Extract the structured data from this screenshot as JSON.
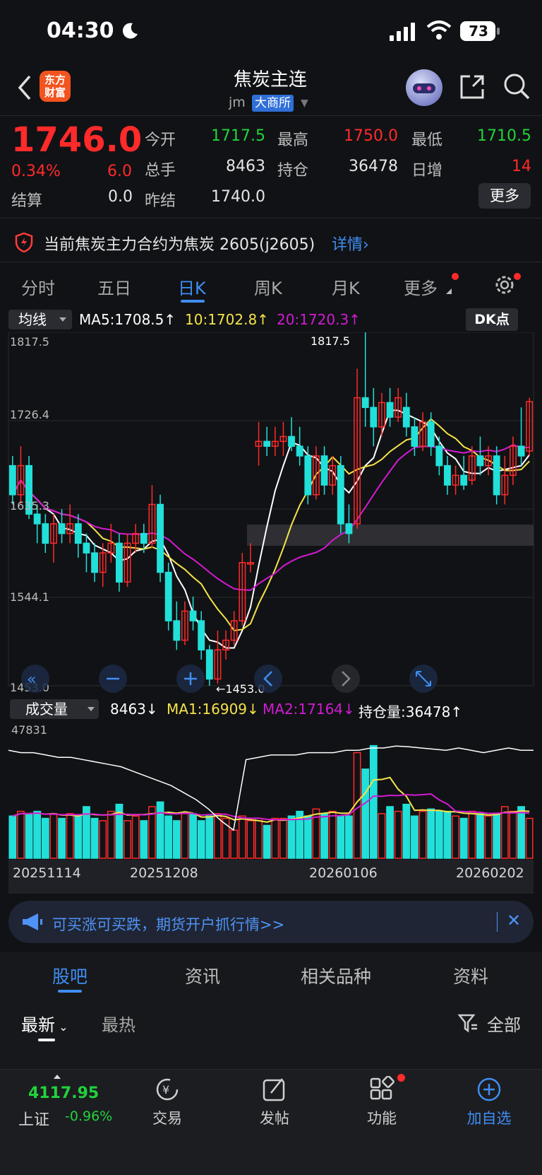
{
  "status_bar": {
    "time": "04:30",
    "battery": "73"
  },
  "header": {
    "app_logo": "东方\n财富",
    "title": "焦炭主连",
    "code": "jm",
    "exchange": "大商所"
  },
  "quote": {
    "last_price": "1746.0",
    "change_pct": "0.34%",
    "change_abs": "6.0",
    "fields": {
      "open_label": "今开",
      "open": "1717.5",
      "high_label": "最高",
      "high": "1750.0",
      "low_label": "最低",
      "low": "1710.5",
      "volume_label": "总手",
      "volume": "8463",
      "oi_label": "持仓",
      "oi": "36478",
      "daily_inc_label": "日增",
      "daily_inc": "14",
      "settle_label": "结算",
      "settle": "0.0",
      "prev_settle_label": "昨结",
      "prev_settle": "1740.0"
    },
    "more_label": "更多"
  },
  "notice": {
    "text": "当前焦炭主力合约为焦炭 2605(j2605)",
    "link": "详情"
  },
  "period_tabs": [
    "分时",
    "五日",
    "日K",
    "周K",
    "月K",
    "更多"
  ],
  "active_period": "日K",
  "chart_header": {
    "ma_dropdown": "均线",
    "ma5": "MA5:1708.5↑",
    "ma10": "10:1702.8↑",
    "ma20": "20:1720.3↑",
    "dk_button": "DK点"
  },
  "volume_header": {
    "dropdown": "成交量",
    "vol": "8463↓",
    "ma1": "MA1:16909↓",
    "ma2": "MA2:17164↓",
    "oi": "持仓量:36478↑"
  },
  "colors": {
    "up": "#ff2a2a",
    "down": "#21e0d9",
    "ma5": "#ffffff",
    "ma10": "#f4e34a",
    "ma20": "#d21bd2",
    "accent": "#3f8ef2"
  },
  "chart_data": {
    "type": "candlestick",
    "y_ticks": [
      "1817.5",
      "1726.4",
      "1635.3",
      "1544.1",
      "1453.0"
    ],
    "ylim": [
      1453.0,
      1817.5
    ],
    "annotations": {
      "max_label": "1817.5",
      "min_label": "←1453.0",
      "vol_max_label": "47831"
    },
    "dates_shown": [
      "20251114",
      "20251208",
      "20260106",
      "20260202"
    ],
    "candles": [
      {
        "o": 1680,
        "c": 1650,
        "h": 1690,
        "l": 1640
      },
      {
        "o": 1650,
        "c": 1680,
        "h": 1700,
        "l": 1640
      },
      {
        "o": 1680,
        "c": 1630,
        "h": 1690,
        "l": 1625
      },
      {
        "o": 1630,
        "c": 1620,
        "h": 1640,
        "l": 1600
      },
      {
        "o": 1620,
        "c": 1600,
        "h": 1630,
        "l": 1590
      },
      {
        "o": 1600,
        "c": 1620,
        "h": 1630,
        "l": 1580
      },
      {
        "o": 1620,
        "c": 1610,
        "h": 1635,
        "l": 1600
      },
      {
        "o": 1610,
        "c": 1620,
        "h": 1640,
        "l": 1600
      },
      {
        "o": 1620,
        "c": 1600,
        "h": 1630,
        "l": 1585
      },
      {
        "o": 1600,
        "c": 1590,
        "h": 1610,
        "l": 1570
      },
      {
        "o": 1590,
        "c": 1570,
        "h": 1600,
        "l": 1560
      },
      {
        "o": 1570,
        "c": 1590,
        "h": 1600,
        "l": 1555
      },
      {
        "o": 1590,
        "c": 1600,
        "h": 1620,
        "l": 1580
      },
      {
        "o": 1600,
        "c": 1560,
        "h": 1610,
        "l": 1550
      },
      {
        "o": 1560,
        "c": 1600,
        "h": 1610,
        "l": 1555
      },
      {
        "o": 1600,
        "c": 1610,
        "h": 1620,
        "l": 1590
      },
      {
        "o": 1610,
        "c": 1600,
        "h": 1620,
        "l": 1590
      },
      {
        "o": 1600,
        "c": 1640,
        "h": 1660,
        "l": 1595
      },
      {
        "o": 1640,
        "c": 1570,
        "h": 1650,
        "l": 1560
      },
      {
        "o": 1570,
        "c": 1520,
        "h": 1580,
        "l": 1510
      },
      {
        "o": 1520,
        "c": 1500,
        "h": 1540,
        "l": 1490
      },
      {
        "o": 1500,
        "c": 1530,
        "h": 1540,
        "l": 1495
      },
      {
        "o": 1530,
        "c": 1520,
        "h": 1545,
        "l": 1510
      },
      {
        "o": 1520,
        "c": 1490,
        "h": 1530,
        "l": 1480
      },
      {
        "o": 1490,
        "c": 1460,
        "h": 1495,
        "l": 1453
      },
      {
        "o": 1460,
        "c": 1490,
        "h": 1510,
        "l": 1455
      },
      {
        "o": 1490,
        "c": 1500,
        "h": 1510,
        "l": 1480
      },
      {
        "o": 1500,
        "c": 1520,
        "h": 1530,
        "l": 1495
      },
      {
        "o": 1520,
        "c": 1580,
        "h": 1590,
        "l": 1515
      },
      {
        "o": 1580,
        "c": 1580,
        "h": 1600,
        "l": 1570
      },
      {
        "o": 1700,
        "c": 1705,
        "h": 1725,
        "l": 1680
      },
      {
        "o": 1705,
        "c": 1700,
        "h": 1720,
        "l": 1690
      },
      {
        "o": 1700,
        "c": 1705,
        "h": 1720,
        "l": 1690
      },
      {
        "o": 1705,
        "c": 1710,
        "h": 1725,
        "l": 1690
      },
      {
        "o": 1710,
        "c": 1700,
        "h": 1730,
        "l": 1695
      },
      {
        "o": 1700,
        "c": 1690,
        "h": 1720,
        "l": 1680
      },
      {
        "o": 1690,
        "c": 1650,
        "h": 1700,
        "l": 1640
      },
      {
        "o": 1650,
        "c": 1690,
        "h": 1700,
        "l": 1645
      },
      {
        "o": 1690,
        "c": 1660,
        "h": 1700,
        "l": 1650
      },
      {
        "o": 1660,
        "c": 1680,
        "h": 1690,
        "l": 1650
      },
      {
        "o": 1680,
        "c": 1620,
        "h": 1690,
        "l": 1610
      },
      {
        "o": 1620,
        "c": 1610,
        "h": 1640,
        "l": 1600
      },
      {
        "o": 1620,
        "c": 1750,
        "h": 1780,
        "l": 1615
      },
      {
        "o": 1750,
        "c": 1740,
        "h": 1817.5,
        "l": 1720
      },
      {
        "o": 1740,
        "c": 1720,
        "h": 1760,
        "l": 1700
      },
      {
        "o": 1720,
        "c": 1745,
        "h": 1755,
        "l": 1710
      },
      {
        "o": 1745,
        "c": 1730,
        "h": 1760,
        "l": 1720
      },
      {
        "o": 1730,
        "c": 1750,
        "h": 1760,
        "l": 1725
      },
      {
        "o": 1740,
        "c": 1720,
        "h": 1755,
        "l": 1710
      },
      {
        "o": 1720,
        "c": 1700,
        "h": 1730,
        "l": 1690
      },
      {
        "o": 1700,
        "c": 1725,
        "h": 1735,
        "l": 1695
      },
      {
        "o": 1725,
        "c": 1700,
        "h": 1735,
        "l": 1690
      },
      {
        "o": 1700,
        "c": 1680,
        "h": 1710,
        "l": 1670
      },
      {
        "o": 1680,
        "c": 1660,
        "h": 1690,
        "l": 1650
      },
      {
        "o": 1660,
        "c": 1670,
        "h": 1680,
        "l": 1650
      },
      {
        "o": 1670,
        "c": 1660,
        "h": 1690,
        "l": 1655
      },
      {
        "o": 1665,
        "c": 1690,
        "h": 1700,
        "l": 1660
      },
      {
        "o": 1690,
        "c": 1680,
        "h": 1710,
        "l": 1670
      },
      {
        "o": 1680,
        "c": 1690,
        "h": 1700,
        "l": 1670
      },
      {
        "o": 1690,
        "c": 1650,
        "h": 1700,
        "l": 1640
      },
      {
        "o": 1650,
        "c": 1670,
        "h": 1690,
        "l": 1640
      },
      {
        "o": 1670,
        "c": 1700,
        "h": 1710,
        "l": 1660
      },
      {
        "o": 1700,
        "c": 1690,
        "h": 1740,
        "l": 1680
      },
      {
        "o": 1695,
        "c": 1746,
        "h": 1750,
        "l": 1690
      }
    ],
    "volumes": [
      18,
      20,
      19,
      20,
      17,
      19,
      17,
      19,
      18,
      22,
      17,
      16,
      20,
      23,
      16,
      18,
      16,
      22,
      24,
      18,
      16,
      19,
      19,
      16,
      18,
      19,
      17,
      12,
      18,
      16,
      17,
      14,
      17,
      17,
      18,
      20,
      18,
      21,
      19,
      20,
      18,
      18,
      45,
      38,
      48,
      19,
      22,
      20,
      23,
      18,
      20,
      21,
      20,
      20,
      18,
      17,
      20,
      19,
      18,
      19,
      22,
      20,
      22,
      17
    ],
    "oi_line": [
      46,
      45,
      45,
      44,
      43,
      43,
      42,
      41,
      40,
      39,
      37,
      35,
      33,
      31,
      28,
      25,
      21,
      16,
      12,
      42,
      43,
      44,
      44,
      44,
      45,
      45,
      45,
      46,
      46,
      47,
      47,
      47.8,
      47.5,
      47,
      46.5,
      46,
      47,
      46,
      45,
      46,
      47,
      46,
      46
    ],
    "vol_ylim": [
      0,
      50
    ]
  },
  "date_labels": [
    "20251114",
    "20251208",
    "20260106",
    "20260202"
  ],
  "ad": {
    "text": "可买涨可买跌，期货开户抓行情>>",
    "close": "✕"
  },
  "section_tabs": [
    "股吧",
    "资讯",
    "相关品种",
    "资料"
  ],
  "sort_tabs": [
    "最新",
    "最热"
  ],
  "filter_label": "全部",
  "bottom_nav": {
    "index_value": "4117.95",
    "index_name": "上证",
    "index_change": "-0.96%",
    "items": [
      "交易",
      "发帖",
      "功能",
      "加自选"
    ]
  }
}
